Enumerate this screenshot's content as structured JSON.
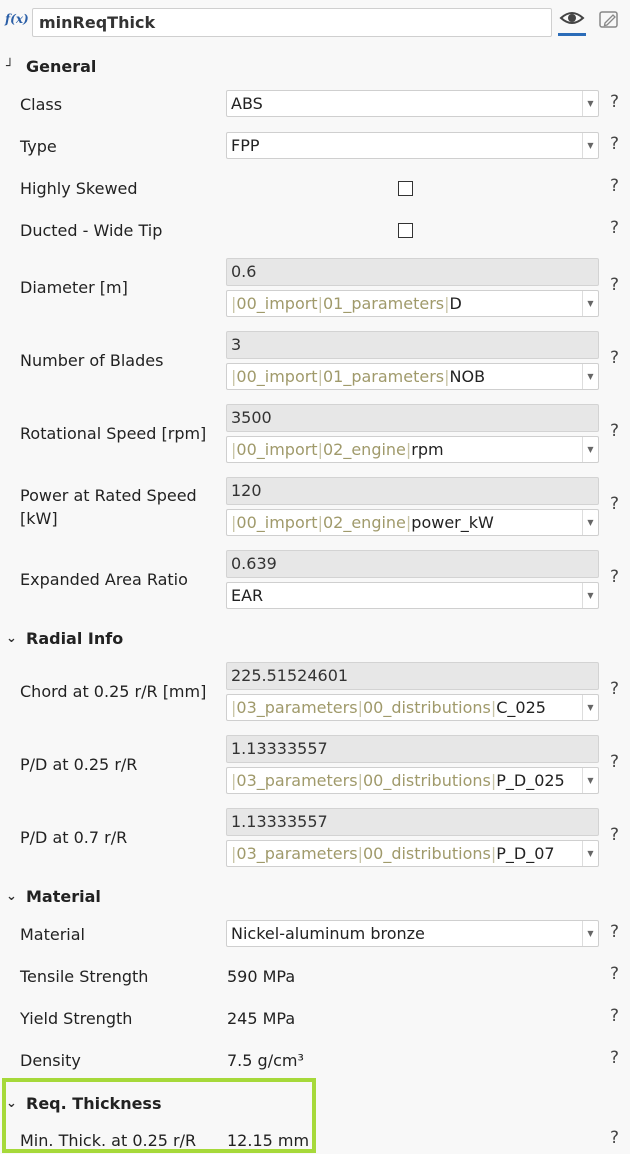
{
  "header": {
    "fx_label": "f(x)",
    "name_value": "minReqThick"
  },
  "sections": {
    "general": "General",
    "radial": "Radial Info",
    "material": "Material",
    "req": "Req. Thickness"
  },
  "help": "?",
  "fields": {
    "class": {
      "label": "Class",
      "value": "ABS"
    },
    "type": {
      "label": "Type",
      "value": "FPP"
    },
    "skewed": {
      "label": "Highly Skewed"
    },
    "ducted": {
      "label": "Ducted - Wide Tip"
    },
    "diameter": {
      "label": "Diameter [m]",
      "value": "0.6",
      "ref": [
        "00_import",
        "01_parameters"
      ],
      "ref_last": "D"
    },
    "blades": {
      "label": "Number of Blades",
      "value": "3",
      "ref": [
        "00_import",
        "01_parameters"
      ],
      "ref_last": "NOB"
    },
    "rpm": {
      "label": "Rotational Speed [rpm]",
      "value": "3500",
      "ref": [
        "00_import",
        "02_engine"
      ],
      "ref_last": "rpm"
    },
    "power": {
      "label_1": "Power at Rated Speed",
      "label_2": "[kW]",
      "value": "120",
      "ref": [
        "00_import",
        "02_engine"
      ],
      "ref_last": "power_kW"
    },
    "ear": {
      "label": "Expanded Area Ratio",
      "value": "0.639",
      "ref_last": "EAR"
    },
    "chord": {
      "label": "Chord at 0.25 r/R [mm]",
      "value": "225.51524601",
      "ref": [
        "03_parameters",
        "00_distributions"
      ],
      "ref_last": "C_025"
    },
    "pd025": {
      "label": "P/D at 0.25 r/R",
      "value": "1.13333557",
      "ref": [
        "03_parameters",
        "00_distributions"
      ],
      "ref_last": "P_D_025"
    },
    "pd07": {
      "label": "P/D at 0.7 r/R",
      "value": "1.13333557",
      "ref": [
        "03_parameters",
        "00_distributions"
      ],
      "ref_last": "P_D_07"
    },
    "material": {
      "label": "Material",
      "value": "Nickel-aluminum bronze"
    },
    "tensile": {
      "label": "Tensile Strength",
      "value": "590 MPa"
    },
    "yield": {
      "label": "Yield Strength",
      "value": "245 MPa"
    },
    "density": {
      "label": "Density",
      "value": "7.5 g/cm³"
    },
    "minthick": {
      "label": "Min. Thick. at 0.25 r/R",
      "value": "12.15 mm"
    }
  },
  "colors": {
    "accent": "#2b6cb8",
    "highlight": "#a6d93a",
    "ref_text": "#a09a6b"
  }
}
